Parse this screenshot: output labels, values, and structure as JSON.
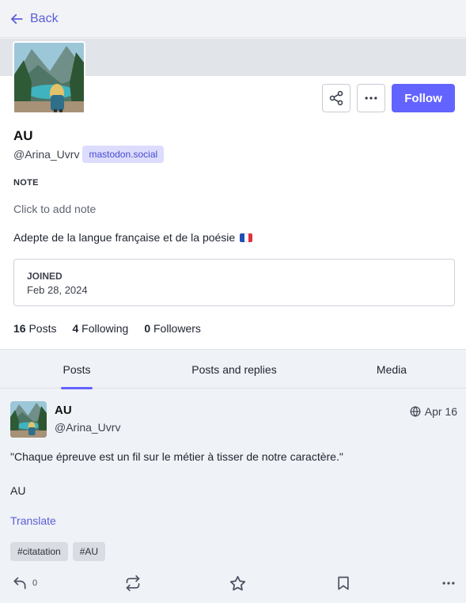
{
  "nav": {
    "back_label": "Back"
  },
  "profile": {
    "display_name": "AU",
    "acct": "@Arina_Uvrv",
    "domain": "mastodon.social",
    "follow_label": "Follow",
    "note_label": "NOTE",
    "note_placeholder": "Click to add note",
    "bio": "Adepte de la langue française et de la poésie",
    "joined_label": "JOINED",
    "joined_date": "Feb 28, 2024",
    "counts": [
      {
        "value": "16",
        "label": "Posts"
      },
      {
        "value": "4",
        "label": "Following"
      },
      {
        "value": "0",
        "label": "Followers"
      }
    ]
  },
  "tabs": [
    {
      "label": "Posts",
      "active": true
    },
    {
      "label": "Posts and replies",
      "active": false
    },
    {
      "label": "Media",
      "active": false
    }
  ],
  "status": {
    "name": "AU",
    "acct": "@Arina_Uvrv",
    "time": "Apr 16",
    "text": "\"Chaque épreuve est un fil sur le métier à tisser de notre caractère.\"",
    "signature": "AU",
    "translate_label": "Translate",
    "hashtags": [
      "#citatation",
      "#AU"
    ],
    "reply_count": "0"
  },
  "colors": {
    "accent": "#6364ff",
    "link": "#5b5ed8",
    "badge_bg": "#dcdcfd"
  },
  "icons": [
    "arrow-left-icon",
    "share-icon",
    "more-icon",
    "globe-icon",
    "reply-icon",
    "boost-icon",
    "star-icon",
    "bookmark-icon",
    "france-flag-icon"
  ]
}
